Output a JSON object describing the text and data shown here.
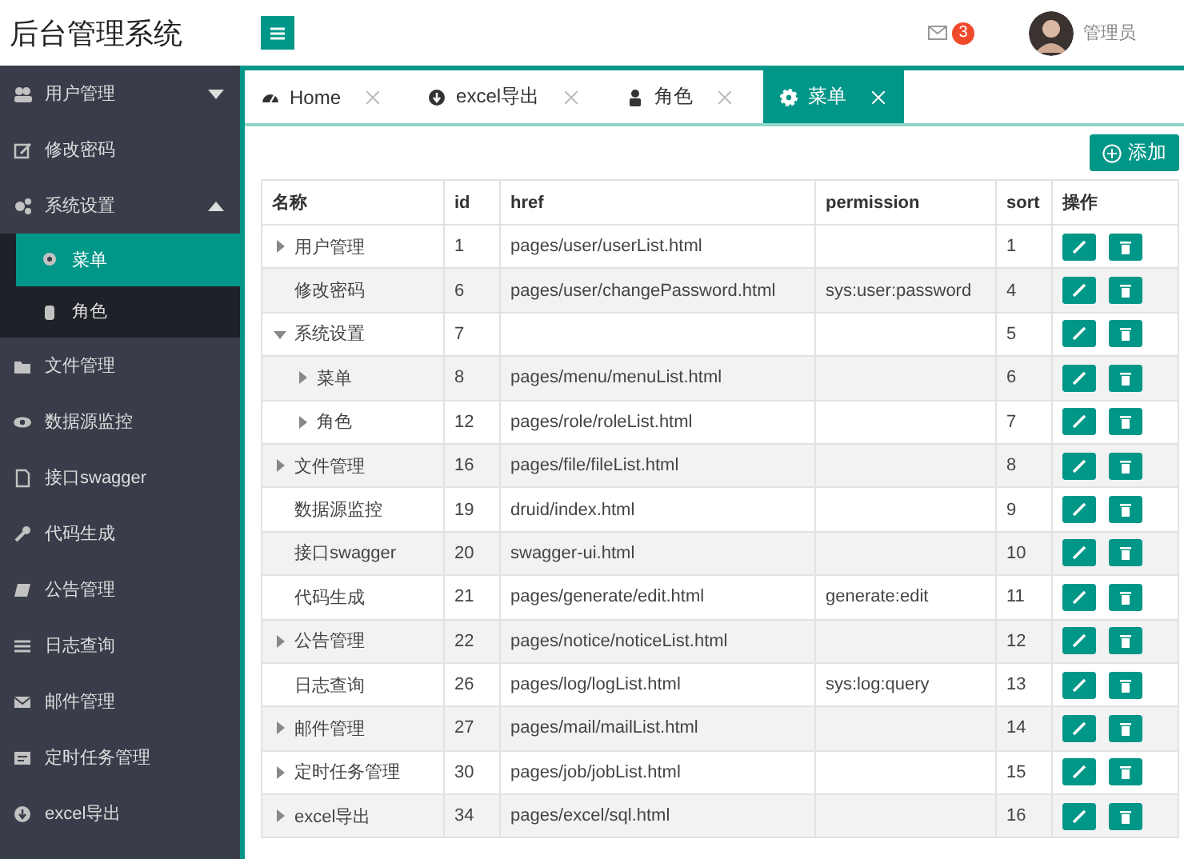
{
  "header": {
    "title": "后台管理系统",
    "mail_badge": "3",
    "user_name": "管理员"
  },
  "sidebar": {
    "items": [
      {
        "label": "用户管理",
        "expanded": false,
        "selected": false
      },
      {
        "label": "修改密码",
        "selected": false
      },
      {
        "label": "系统设置",
        "expanded": true,
        "selected": false,
        "children": [
          {
            "label": "菜单",
            "selected": true
          },
          {
            "label": "角色",
            "selected": false
          }
        ]
      },
      {
        "label": "文件管理",
        "selected": false
      },
      {
        "label": "数据源监控",
        "selected": false
      },
      {
        "label": "接口swagger",
        "selected": false
      },
      {
        "label": "代码生成",
        "selected": false
      },
      {
        "label": "公告管理",
        "selected": false
      },
      {
        "label": "日志查询",
        "selected": false
      },
      {
        "label": "邮件管理",
        "selected": false
      },
      {
        "label": "定时任务管理",
        "selected": false
      },
      {
        "label": "excel导出",
        "selected": false
      }
    ]
  },
  "tabs": [
    {
      "label": "Home",
      "selected": false
    },
    {
      "label": "excel导出",
      "selected": false
    },
    {
      "label": "角色",
      "selected": false
    },
    {
      "label": "菜单",
      "selected": true
    }
  ],
  "add_button": "添加",
  "table": {
    "columns": [
      "名称",
      "id",
      "href",
      "permission",
      "sort",
      "操作"
    ],
    "rows": [
      {
        "name": "用户管理",
        "kind": "branch",
        "expanded": false,
        "id": "1",
        "href": "pages/user/userList.html",
        "sort": "1"
      },
      {
        "name": "修改密码",
        "kind": "leaf",
        "id": "6",
        "href": "pages/user/changePassword.html",
        "permission": "sys:user:password",
        "sort": "4"
      },
      {
        "name": "系统设置",
        "kind": "branch",
        "expanded": true,
        "id": "7",
        "sort": "5",
        "children": [
          {
            "name": "菜单",
            "kind": "branch",
            "expanded": false,
            "id": "8",
            "href": "pages/menu/menuList.html",
            "sort": "6"
          },
          {
            "name": "角色",
            "kind": "branch",
            "expanded": false,
            "id": "12",
            "href": "pages/role/roleList.html",
            "sort": "7"
          }
        ]
      },
      {
        "name": "文件管理",
        "kind": "branch",
        "expanded": false,
        "id": "16",
        "href": "pages/file/fileList.html",
        "sort": "8"
      },
      {
        "name": "数据源监控",
        "kind": "leaf",
        "id": "19",
        "href": "druid/index.html",
        "sort": "9"
      },
      {
        "name": "接口swagger",
        "kind": "leaf",
        "id": "20",
        "href": "swagger-ui.html",
        "sort": "10"
      },
      {
        "name": "代码生成",
        "kind": "leaf",
        "id": "21",
        "href": "pages/generate/edit.html",
        "permission": "generate:edit",
        "sort": "11"
      },
      {
        "name": "公告管理",
        "kind": "branch",
        "expanded": false,
        "id": "22",
        "href": "pages/notice/noticeList.html",
        "sort": "12"
      },
      {
        "name": "日志查询",
        "kind": "leaf",
        "id": "26",
        "href": "pages/log/logList.html",
        "permission": "sys:log:query",
        "sort": "13"
      },
      {
        "name": "邮件管理",
        "kind": "branch",
        "expanded": false,
        "id": "27",
        "href": "pages/mail/mailList.html",
        "sort": "14"
      },
      {
        "name": "定时任务管理",
        "kind": "branch",
        "expanded": false,
        "id": "30",
        "href": "pages/job/jobList.html",
        "sort": "15"
      },
      {
        "name": "excel导出",
        "kind": "branch",
        "expanded": false,
        "id": "34",
        "href": "pages/excel/sql.html",
        "sort": "16"
      }
    ]
  }
}
